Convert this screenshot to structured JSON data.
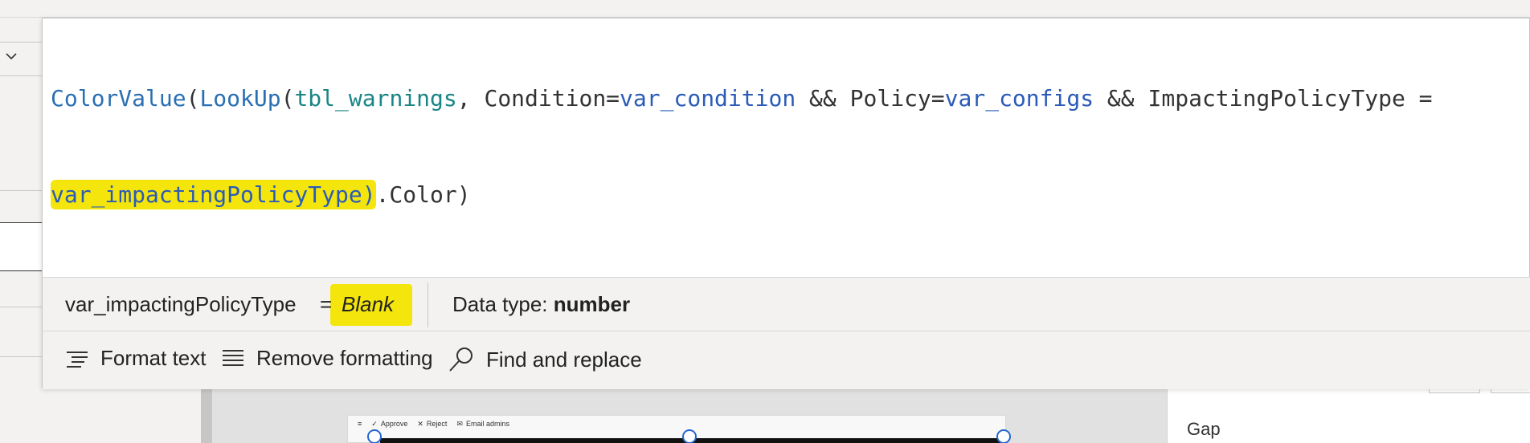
{
  "formula": {
    "line1": [
      {
        "t": "ColorValue",
        "c": "fn"
      },
      {
        "t": "(",
        "c": "plain"
      },
      {
        "t": "LookUp",
        "c": "fn"
      },
      {
        "t": "(",
        "c": "plain"
      },
      {
        "t": "tbl_warnings",
        "c": "tbl"
      },
      {
        "t": ", Condition=",
        "c": "plain"
      },
      {
        "t": "var_condition",
        "c": "var"
      },
      {
        "t": " && Policy=",
        "c": "plain"
      },
      {
        "t": "var_configs",
        "c": "var"
      },
      {
        "t": " && ImpactingPolicyType =",
        "c": "plain"
      }
    ],
    "line2_highlighted": "var_impactingPolicyType)",
    "line2_rest": ".Color)"
  },
  "info_bar": {
    "variable_name": "var_impactingPolicyType",
    "equals": "=",
    "value": "Blank",
    "data_type_label": "Data type:",
    "data_type_value": "number"
  },
  "toolbar": {
    "format_text": "Format text",
    "remove_formatting": "Remove formatting",
    "find_and_replace": "Find and replace"
  },
  "canvas_preview": {
    "approve": "Approve",
    "reject": "Reject",
    "email_admins": "Email admins"
  },
  "properties": {
    "gap_label": "Gap"
  },
  "colors": {
    "function": "#2a6fb3",
    "table": "#1a8585",
    "variable": "#2b5bb7",
    "highlight": "#f4e60d"
  }
}
